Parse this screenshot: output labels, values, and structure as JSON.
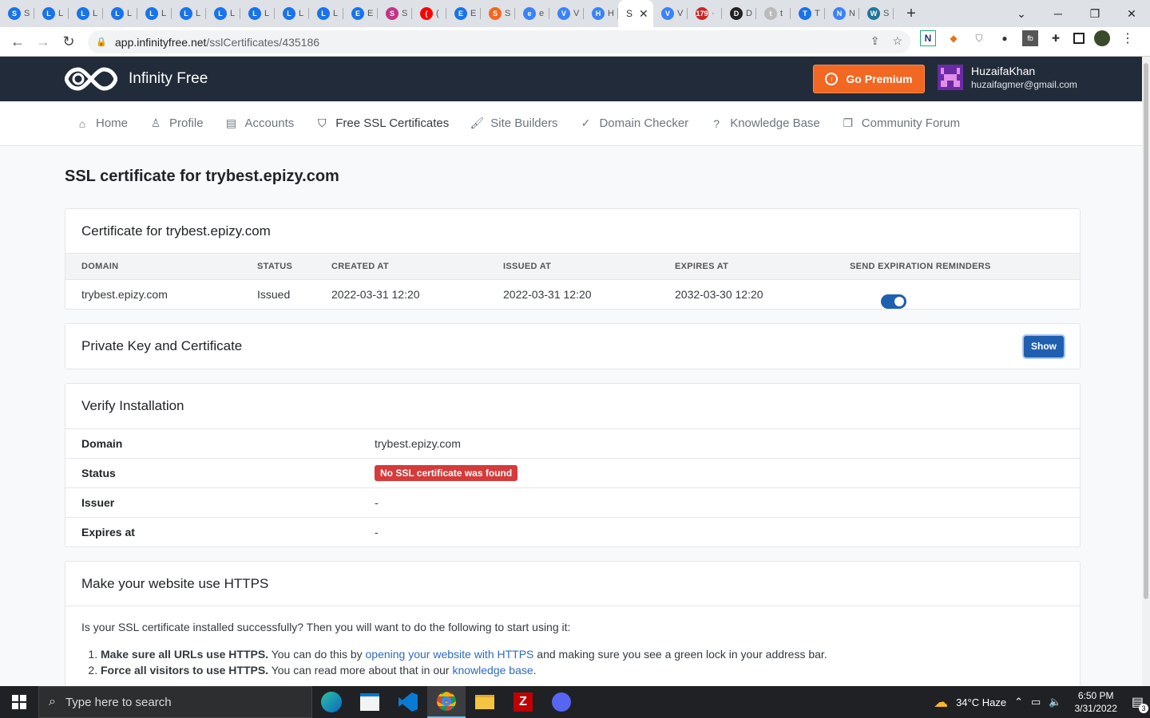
{
  "browser": {
    "tabs": [
      {
        "letter": "S",
        "color": "#1a73e8",
        "label": "S"
      },
      {
        "letter": "L",
        "color": "#1a73e8",
        "label": "L"
      },
      {
        "letter": "L",
        "color": "#1a73e8",
        "label": "L"
      },
      {
        "letter": "L",
        "color": "#1a73e8",
        "label": "L"
      },
      {
        "letter": "L",
        "color": "#1a73e8",
        "label": "L"
      },
      {
        "letter": "L",
        "color": "#1a73e8",
        "label": "L"
      },
      {
        "letter": "L",
        "color": "#1a73e8",
        "label": "L"
      },
      {
        "letter": "L",
        "color": "#1a73e8",
        "label": "L"
      },
      {
        "letter": "L",
        "color": "#1a73e8",
        "label": "L"
      },
      {
        "letter": "L",
        "color": "#1a73e8",
        "label": "L"
      },
      {
        "letter": "E",
        "color": "#1a73e8",
        "label": "E"
      },
      {
        "letter": "S",
        "color": "#c13584",
        "label": "S"
      },
      {
        "letter": "(",
        "color": "#ff0000",
        "label": "("
      },
      {
        "letter": "E",
        "color": "#1a73e8",
        "label": "E"
      },
      {
        "letter": "S",
        "color": "#f26722",
        "label": "S"
      },
      {
        "letter": "e",
        "color": "#3b82f6",
        "label": "e"
      },
      {
        "letter": "V",
        "color": "#3b82f6",
        "label": "V"
      },
      {
        "letter": "H",
        "color": "#3b82f6",
        "label": "H"
      }
    ],
    "active_tab": {
      "label": "S",
      "close": "✕"
    },
    "tabs_after": [
      {
        "letter": "V",
        "color": "#3b82f6",
        "label": "V"
      },
      {
        "letter": "179",
        "color": "#c62828",
        "label": "·"
      },
      {
        "letter": "D",
        "color": "#222",
        "label": "D"
      },
      {
        "letter": "t",
        "color": "#bbb",
        "label": "t"
      },
      {
        "letter": "T",
        "color": "#1a73e8",
        "label": "T"
      },
      {
        "letter": "N",
        "color": "#3b82f6",
        "label": "N"
      },
      {
        "letter": "W",
        "color": "#21759b",
        "label": "S"
      }
    ],
    "new_tab": "+",
    "url_host": "app.infinityfree.net",
    "url_path": "/sslCertificates/435186"
  },
  "header": {
    "brand": "Infinity Free",
    "premium_label": "Go Premium",
    "user_name": "HuzaifaKhan",
    "user_email": "huzaifagmer@gmail.com"
  },
  "nav": {
    "home": "Home",
    "profile": "Profile",
    "accounts": "Accounts",
    "ssl": "Free SSL Certificates",
    "builders": "Site Builders",
    "domain_checker": "Domain Checker",
    "kb": "Knowledge Base",
    "forum": "Community Forum"
  },
  "page": {
    "title": "SSL certificate for trybest.epizy.com"
  },
  "certificate": {
    "heading": "Certificate for trybest.epizy.com",
    "columns": [
      "DOMAIN",
      "STATUS",
      "CREATED AT",
      "ISSUED AT",
      "EXPIRES AT",
      "SEND EXPIRATION REMINDERS"
    ],
    "row": {
      "domain": "trybest.epizy.com",
      "status": "Issued",
      "created": "2022-03-31 12:20",
      "issued": "2022-03-31 12:20",
      "expires": "2032-03-30 12:20",
      "reminders_on": true
    }
  },
  "private_key": {
    "heading": "Private Key and Certificate",
    "button": "Show"
  },
  "verify": {
    "heading": "Verify Installation",
    "rows": [
      {
        "label": "Domain",
        "value": "trybest.epizy.com"
      },
      {
        "label": "Status",
        "value": "No SSL certificate was found"
      },
      {
        "label": "Issuer",
        "value": "-"
      },
      {
        "label": "Expires at",
        "value": "-"
      }
    ]
  },
  "https": {
    "heading": "Make your website use HTTPS",
    "intro": "Is your SSL certificate installed successfully? Then you will want to do the following to start using it:",
    "step1_bold": "Make sure all URLs use HTTPS.",
    "step1_pre": "You can do this by",
    "step1_link": "opening your website with HTTPS",
    "step1_post": "and making sure you see a green lock in your address bar.",
    "step2_bold": "Force all visitors to use HTTPS.",
    "step2_pre": "You can read more about that in our",
    "step2_link": "knowledge base",
    "step2_post": "."
  },
  "taskbar": {
    "search_placeholder": "Type here to search",
    "weather": "34°C  Haze",
    "time": "6:50 PM",
    "date": "3/31/2022",
    "notifications": "3"
  },
  "colors": {
    "header_bg": "#222b39",
    "premium": "#f26722",
    "primary": "#1f5fb0",
    "danger": "#d63a3a"
  }
}
